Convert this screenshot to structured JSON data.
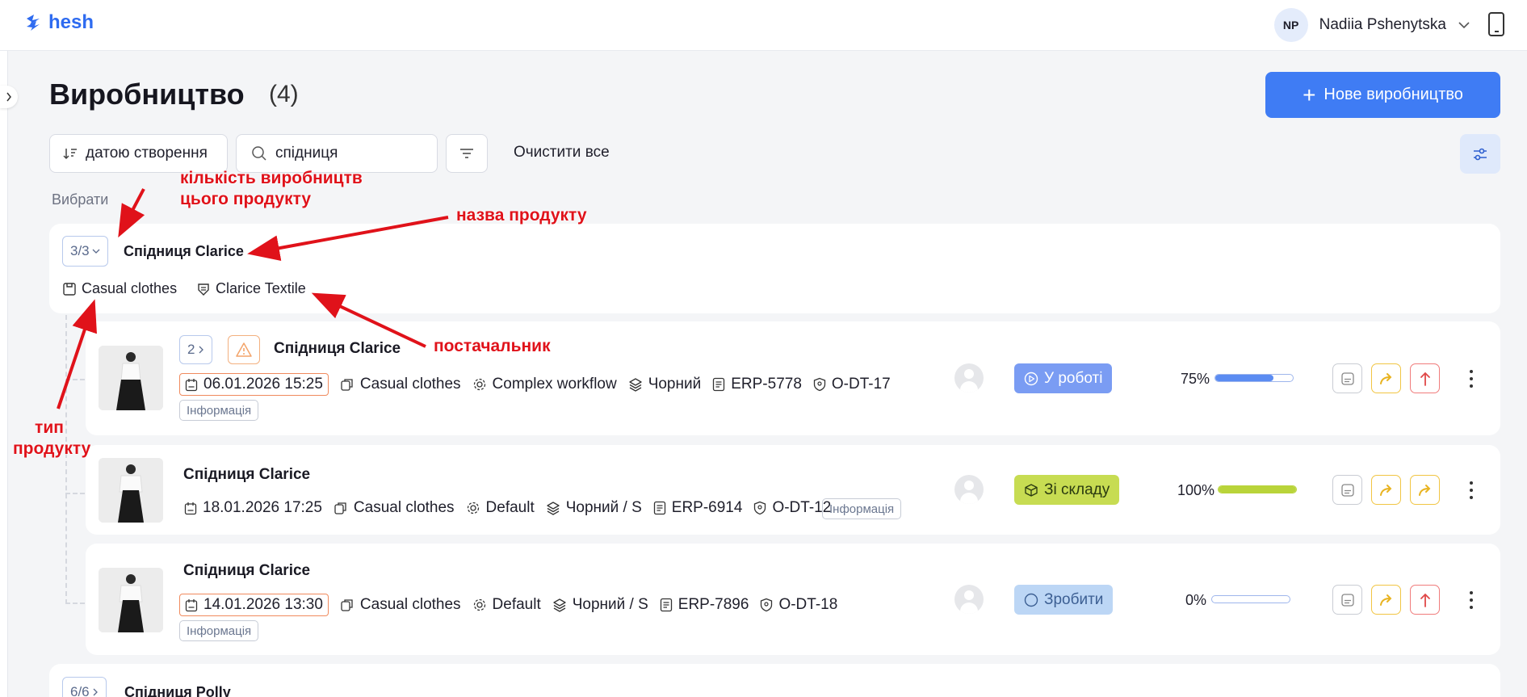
{
  "header": {
    "logo_text": "hesh",
    "user_initials": "NP",
    "user_name": "Nadiia Pshenytska"
  },
  "page": {
    "title": "Виробництво",
    "count": "(4)",
    "new_button": "Нове виробництво"
  },
  "toolbar": {
    "sort_label": "датою створення",
    "search_value": "спідниця",
    "clear_all": "Очистити все",
    "select_label": "Вибрати"
  },
  "groups": [
    {
      "count": "3/3",
      "name": "Спідниця Clarice",
      "product_type": "Casual clothes",
      "supplier": "Clarice Textile"
    },
    {
      "count": "6/6",
      "name": "Спідниця Polly"
    }
  ],
  "rows": [
    {
      "sub_count": "2",
      "has_warning": true,
      "title": "Спідниця Clarice",
      "date": "06.01.2026 15:25",
      "date_highlight": true,
      "type": "Casual clothes",
      "workflow": "Complex workflow",
      "variant": "Чорний",
      "erp": "ERP-5778",
      "order": "O-DT-17",
      "info": "Інформація",
      "status": "У роботі",
      "status_color": "#7a9cf3",
      "progress_text": "75%",
      "progress": 0.75,
      "progress_color": "#5b8cf2",
      "last_action": "red-up"
    },
    {
      "title": "Спідниця Clarice",
      "date": "18.01.2026 17:25",
      "date_highlight": false,
      "type": "Casual clothes",
      "workflow": "Default",
      "variant": "Чорний / S",
      "erp": "ERP-6914",
      "order": "O-DT-12",
      "info": "Інформація",
      "status": "Зі складу",
      "status_color": "#c7dc52",
      "progress_text": "100%",
      "progress": 1.0,
      "progress_color": "#b9d43a",
      "last_action": "yellow"
    },
    {
      "title": "Спідниця Clarice",
      "date": "14.01.2026 13:30",
      "date_highlight": true,
      "type": "Casual clothes",
      "workflow": "Default",
      "variant": "Чорний / S",
      "erp": "ERP-7896",
      "order": "O-DT-18",
      "info": "Інформація",
      "status": "Зробити",
      "status_color": "#bcd6f5",
      "progress_text": "0%",
      "progress": 0,
      "progress_color": "#5b8cf2",
      "last_action": "red-up"
    }
  ],
  "annotations": {
    "count_note": "кількість виробництв цього продукту",
    "name_note": "назва продукту",
    "supplier_note": "постачальник",
    "type_note": "тип продукту"
  },
  "colors": {
    "accent": "#3f7cf4",
    "annotation": "#e0121a",
    "warning": "#f08a5d"
  }
}
